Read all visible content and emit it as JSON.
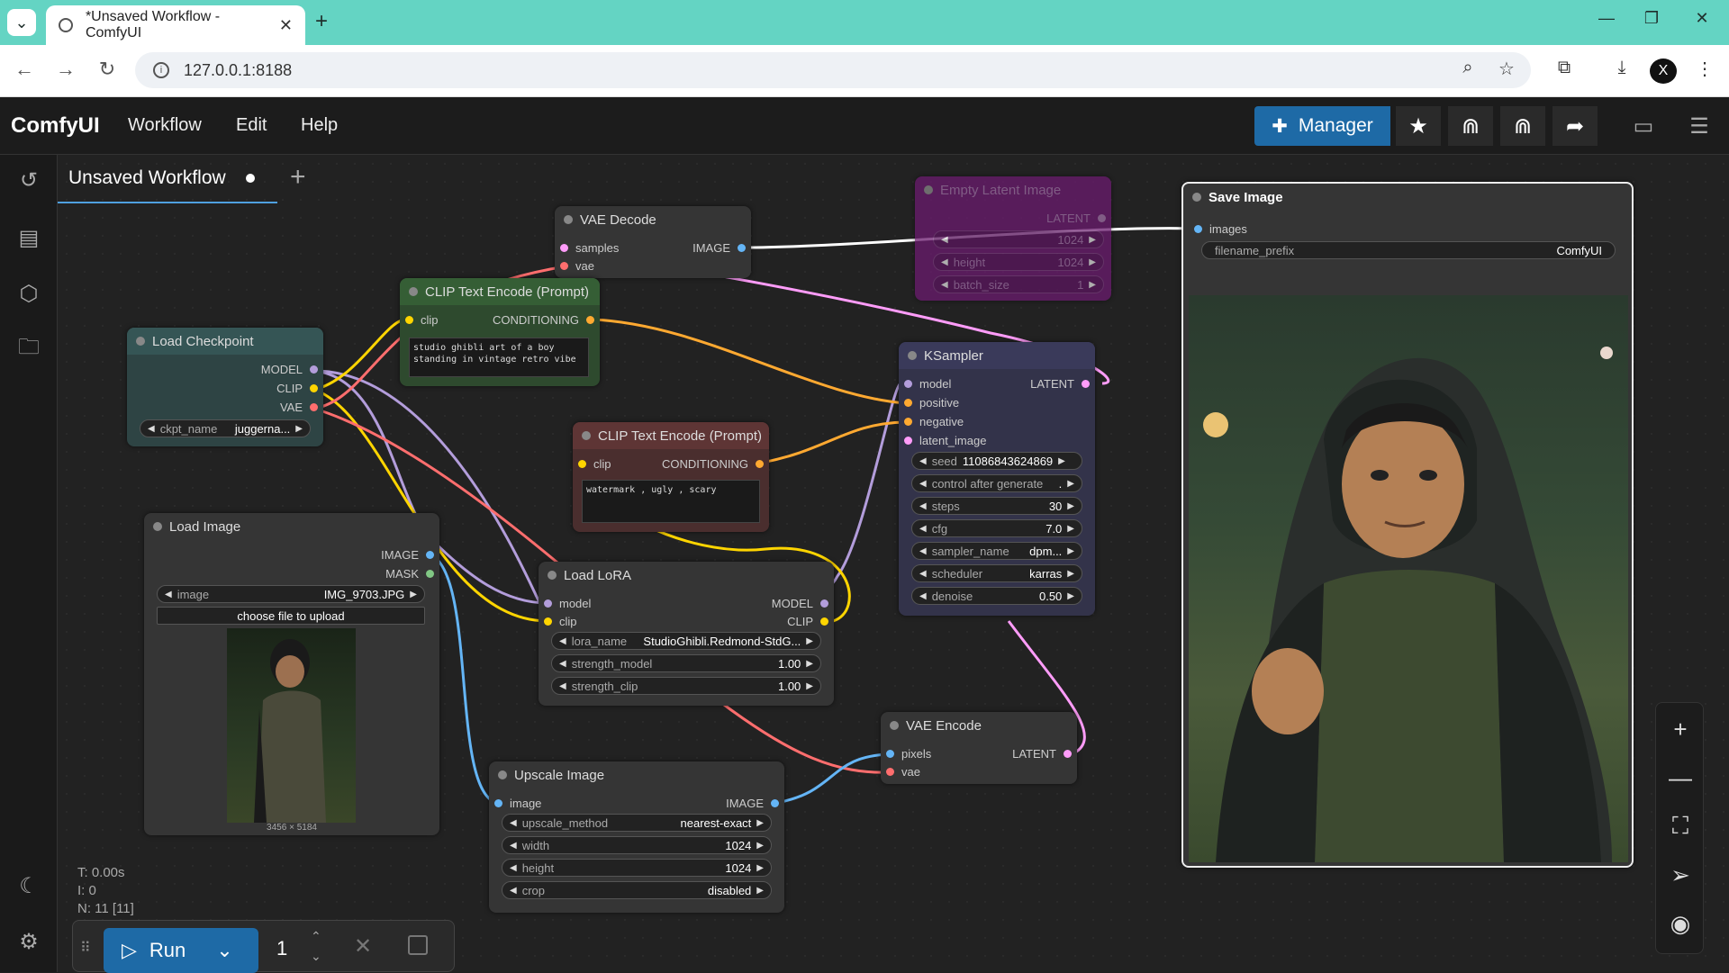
{
  "browser": {
    "tab_title": "*Unsaved Workflow - ComfyUI",
    "url": "127.0.0.1:8188"
  },
  "app": {
    "brand": "ComfyUI",
    "menu": [
      "Workflow",
      "Edit",
      "Help"
    ],
    "manager_label": "Manager",
    "workflow_tab": "Unsaved Workflow"
  },
  "nodes": {
    "vae_decode": {
      "title": "VAE Decode",
      "in1": "samples",
      "in2": "vae",
      "out1": "IMAGE"
    },
    "empty_latent": {
      "title": "Empty Latent Image",
      "out1": "LATENT",
      "w1": "1024",
      "w2l": "height",
      "w2": "1024",
      "w3l": "batch_size",
      "w3": "1"
    },
    "save_image": {
      "title": "Save Image",
      "in1": "images",
      "prefix_label": "filename_prefix",
      "prefix_value": "ComfyUI"
    },
    "clip_pos": {
      "title": "CLIP Text Encode (Prompt)",
      "in1": "clip",
      "out1": "CONDITIONING",
      "text": "studio ghibli art of a boy\nstanding in vintage retro vibe"
    },
    "clip_neg": {
      "title": "CLIP Text Encode (Prompt)",
      "in1": "clip",
      "out1": "CONDITIONING",
      "text": "watermark , ugly , scary"
    },
    "load_ckpt": {
      "title": "Load Checkpoint",
      "out1": "MODEL",
      "out2": "CLIP",
      "out3": "VAE",
      "w_label": "ckpt_name",
      "w_value": "juggerna..."
    },
    "ksampler": {
      "title": "KSampler",
      "in1": "model",
      "in2": "positive",
      "in3": "negative",
      "in4": "latent_image",
      "out1": "LATENT",
      "seed_label": "seed",
      "seed": "11086843624869",
      "control_label": "control after generate",
      "control": ".",
      "steps_label": "steps",
      "steps": "30",
      "cfg_label": "cfg",
      "cfg": "7.0",
      "sampler_label": "sampler_name",
      "sampler": "dpm...",
      "scheduler_label": "scheduler",
      "scheduler": "karras",
      "denoise_label": "denoise",
      "denoise": "0.50"
    },
    "load_image": {
      "title": "Load Image",
      "out1": "IMAGE",
      "out2": "MASK",
      "w_label": "image",
      "w_value": "IMG_9703.JPG",
      "upload": "choose file to upload",
      "dims": "3456 × 5184"
    },
    "load_lora": {
      "title": "Load LoRA",
      "in1": "model",
      "in2": "clip",
      "out1": "MODEL",
      "out2": "CLIP",
      "lora_label": "lora_name",
      "lora": "StudioGhibli.Redmond-StdG...",
      "sm_label": "strength_model",
      "sm": "1.00",
      "sc_label": "strength_clip",
      "sc": "1.00"
    },
    "vae_encode": {
      "title": "VAE Encode",
      "in1": "pixels",
      "in2": "vae",
      "out1": "LATENT"
    },
    "upscale": {
      "title": "Upscale Image",
      "in1": "image",
      "out1": "IMAGE",
      "m_label": "upscale_method",
      "m": "nearest-exact",
      "w_label": "width",
      "w": "1024",
      "h_label": "height",
      "h": "1024",
      "c_label": "crop",
      "c": "disabled"
    }
  },
  "stats": {
    "t": "T: 0.00s",
    "i": "I: 0",
    "n": "N: 11 [11]"
  },
  "run": {
    "label": "Run",
    "count": "1"
  },
  "colors": {
    "accent": "#1e6aa6",
    "model": "#b39ddb",
    "clip": "#ffd500",
    "vae": "#ff6e6e",
    "latent": "#ff9cf9",
    "image": "#64b5f6",
    "conditioning": "#ffa931"
  }
}
